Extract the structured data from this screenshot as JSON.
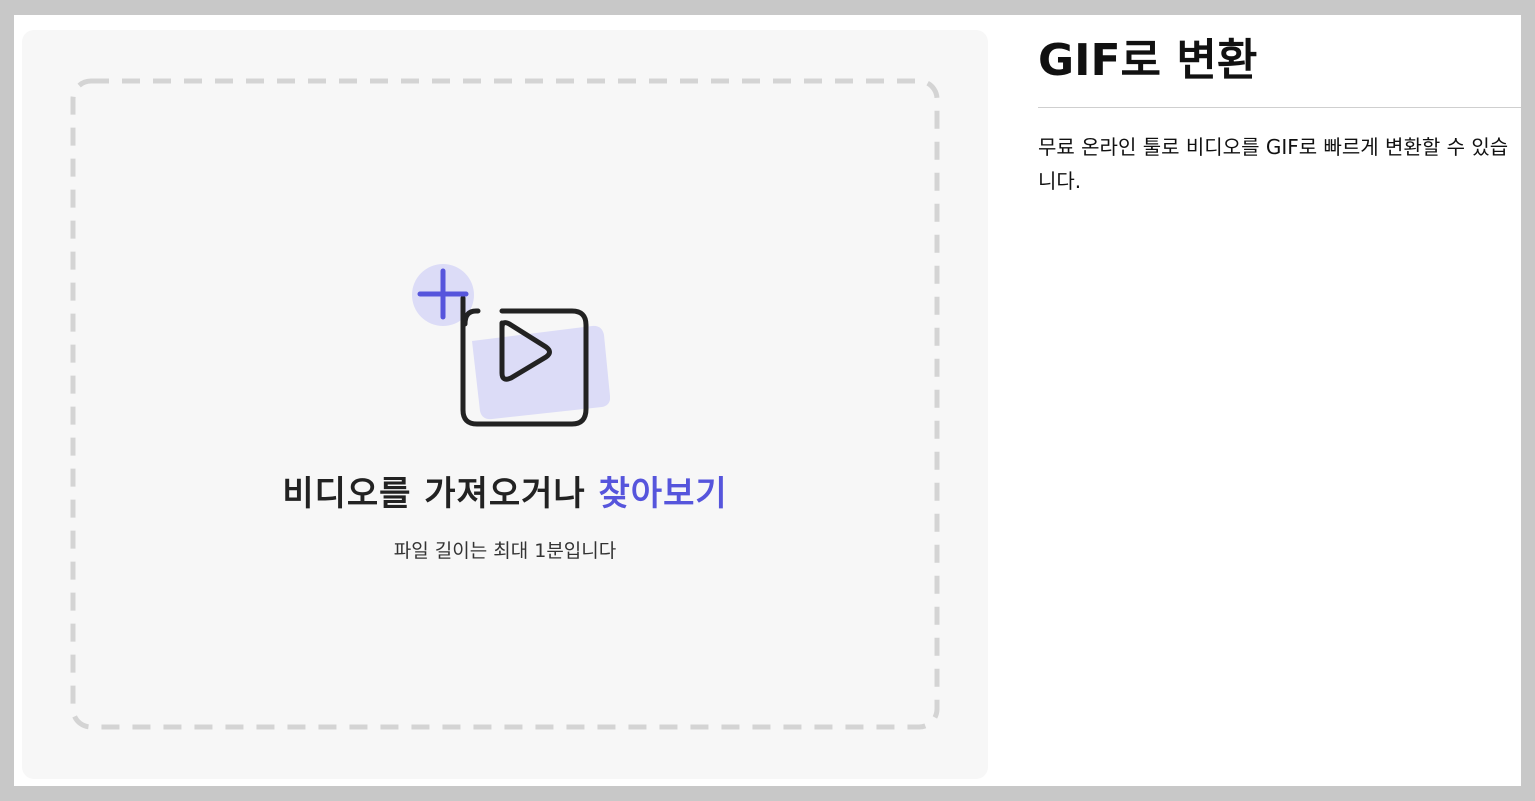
{
  "upload": {
    "title_prefix": "비디오를 가져오거나 ",
    "browse_label": "찾아보기",
    "hint": "파일 길이는 최대 1분입니다",
    "icon": "add-video-icon"
  },
  "info": {
    "title": "GIF로 변환",
    "description": "무료 온라인 툴로 비디오를 GIF로 빠르게 변환할 수 있습니다."
  },
  "colors": {
    "accent": "#5655dc",
    "accent_light": "#dcdcf7",
    "panel_bg": "#f7f7f7",
    "dash_border": "#d4d4d4",
    "outer_bg": "#c8c8c8"
  }
}
